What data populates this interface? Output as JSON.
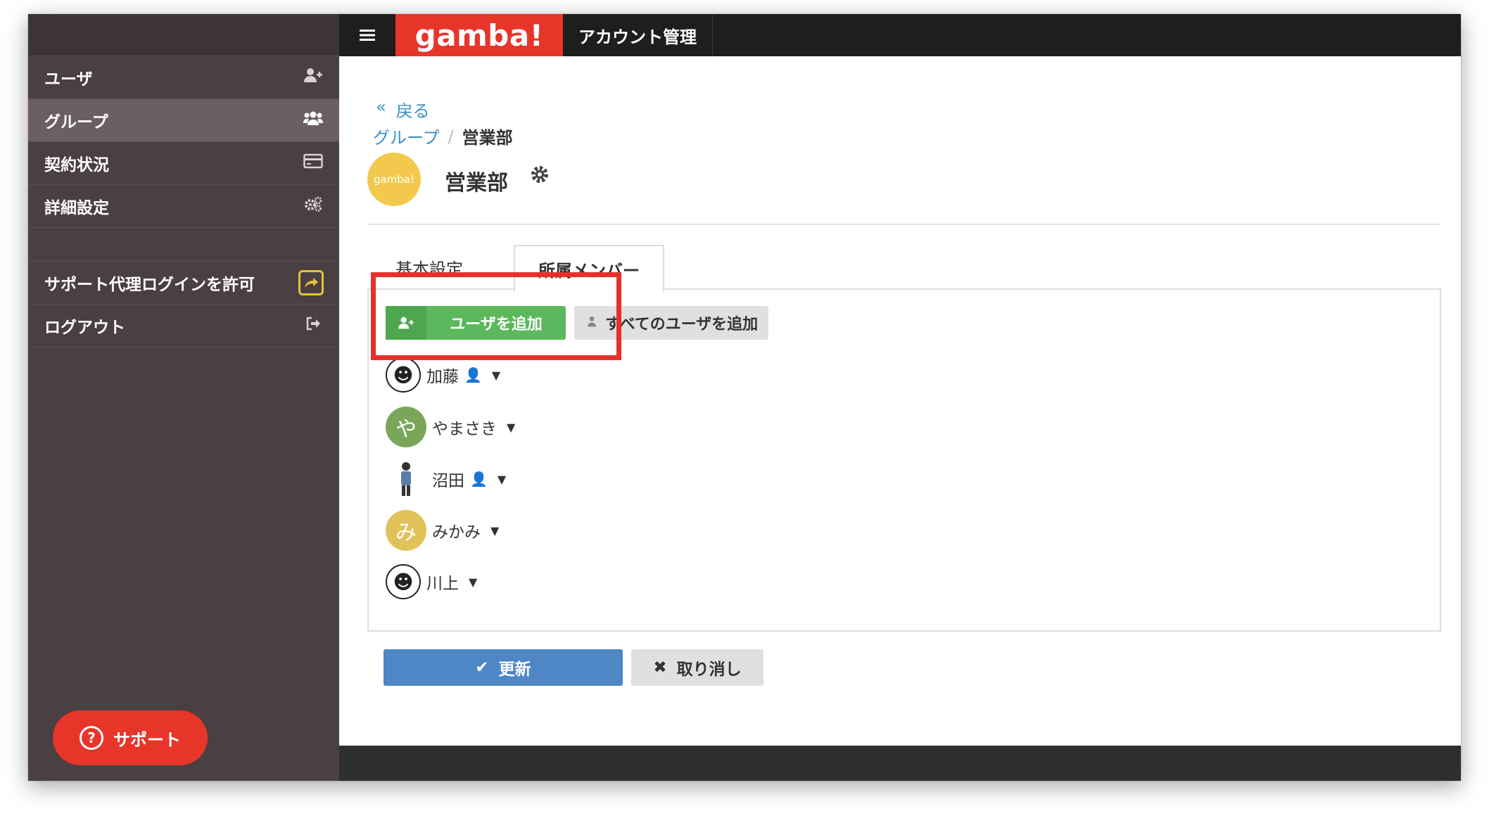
{
  "header": {
    "menu_icon": "hamburger-icon",
    "brand": "gamba!",
    "title": "アカウント管理"
  },
  "sidebar": {
    "items": [
      {
        "label": "ユーザ",
        "icon": "user-plus-icon",
        "active": false
      },
      {
        "label": "グループ",
        "icon": "users-icon",
        "active": true
      },
      {
        "label": "契約状況",
        "icon": "credit-card-icon",
        "active": false
      },
      {
        "label": "詳細設定",
        "icon": "gears-icon",
        "active": false
      }
    ],
    "support_login": {
      "label": "サポート代理ログインを許可",
      "icon": "share-icon"
    },
    "logout": {
      "label": "ログアウト",
      "icon": "sign-out-icon"
    },
    "help_button": "サポート"
  },
  "main": {
    "back": "戻る",
    "breadcrumb": {
      "parent": "グループ",
      "current": "営業部"
    },
    "group": {
      "logo_text": "gamba!",
      "name": "営業部"
    },
    "tabs": [
      {
        "label": "基本設定",
        "active": false
      },
      {
        "label": "所属メンバー",
        "active": true
      }
    ],
    "add_user_button": "ユーザを追加",
    "add_all_button": "すべてのユーザを追加",
    "members": [
      {
        "name": "加藤",
        "admin": true,
        "avatar": "face"
      },
      {
        "name": "やまさき",
        "admin": false,
        "avatar": "や",
        "color": "#7aa65a"
      },
      {
        "name": "沼田",
        "admin": true,
        "avatar": "person"
      },
      {
        "name": "みかみ",
        "admin": false,
        "avatar": "み",
        "color": "#e0c258"
      },
      {
        "name": "川上",
        "admin": false,
        "avatar": "face"
      }
    ],
    "save_button": "更新",
    "cancel_button": "取り消し"
  },
  "colors": {
    "brand": "#e8352a",
    "sidebar": "#4a3f42",
    "primary": "#4f86c6",
    "success": "#5cb85c",
    "highlight": "#e8302a"
  }
}
